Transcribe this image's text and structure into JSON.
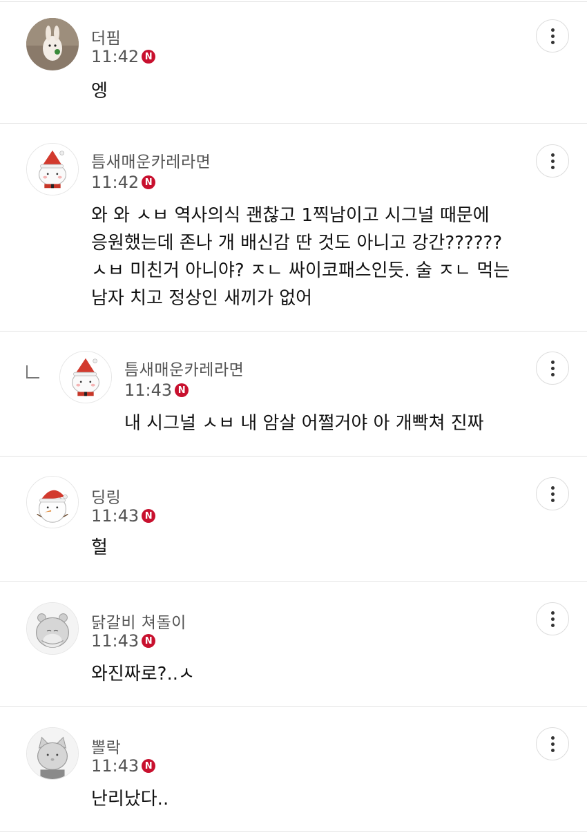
{
  "comments": [
    {
      "author": "더핌",
      "time": "11:42",
      "badge": "N",
      "text": "엥",
      "avatar_icon": "rabbit-photo-icon"
    },
    {
      "author": "틈새매운카레라면",
      "time": "11:42",
      "badge": "N",
      "text": "와 와 ㅅㅂ 역사의식 괜찮고 1찍남이고 시그널 때문에\n응원했는데 존나 개 배신감 딴 것도 아니고 강간??????\nㅅㅂ 미친거 아니야? ㅈㄴ 싸이코패스인듯. 술 ㅈㄴ 먹는\n남자 치고 정상인 새끼가 없어",
      "avatar_icon": "santa-cat-icon"
    },
    {
      "author": "틈새매운카레라면",
      "time": "11:43",
      "badge": "N",
      "text": "내 시그널 ㅅㅂ 내 암살 어쩔거야 아 개빡쳐 진짜",
      "avatar_icon": "santa-cat-icon",
      "reply": true
    },
    {
      "author": "딩링",
      "time": "11:43",
      "badge": "N",
      "text": "헐",
      "avatar_icon": "snowman-icon"
    },
    {
      "author": "닭갈비 쳐돌이",
      "time": "11:43",
      "badge": "N",
      "text": "와진짜로?..ㅅ",
      "avatar_icon": "gray-hamster-icon"
    },
    {
      "author": "뽈락",
      "time": "11:43",
      "badge": "N",
      "text": "난리났다..",
      "avatar_icon": "gray-cat-icon"
    }
  ],
  "colors": {
    "badge": "#c8102e",
    "divider": "#e3e3e3",
    "meta_text": "#555555"
  }
}
